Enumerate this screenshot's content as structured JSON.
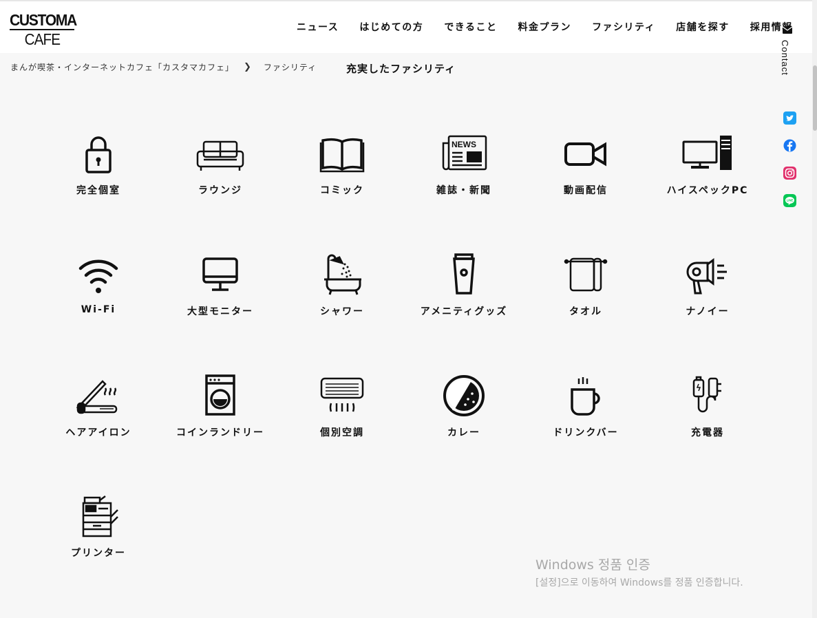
{
  "logo": {
    "line1": "CUSTOMA",
    "line2": "CAFE"
  },
  "nav": [
    "ニュース",
    "はじめての方",
    "できること",
    "料金プラン",
    "ファシリティ",
    "店舗を探す",
    "採用情報"
  ],
  "breadcrumb": {
    "home": "まんが喫茶・インターネットカフェ「カスタマカフェ」",
    "current": "ファシリティ"
  },
  "page_title": "充実したファシリティ",
  "facilities": [
    {
      "label": "完全個室",
      "icon": "padlock-icon"
    },
    {
      "label": "ラウンジ",
      "icon": "sofa-icon"
    },
    {
      "label": "コミック",
      "icon": "open-book-icon"
    },
    {
      "label": "雑誌・新聞",
      "icon": "newspaper-icon"
    },
    {
      "label": "動画配信",
      "icon": "video-camera-icon"
    },
    {
      "label": "ハイスペックPC",
      "icon": "desktop-pc-icon"
    },
    {
      "label": "Wi-Fi",
      "icon": "wifi-icon"
    },
    {
      "label": "大型モニター",
      "icon": "monitor-icon"
    },
    {
      "label": "シャワー",
      "icon": "shower-bath-icon"
    },
    {
      "label": "アメニティグッズ",
      "icon": "tube-icon"
    },
    {
      "label": "タオル",
      "icon": "towel-icon"
    },
    {
      "label": "ナノイー",
      "icon": "hair-dryer-icon"
    },
    {
      "label": "ヘアアイロン",
      "icon": "hair-iron-icon"
    },
    {
      "label": "コインランドリー",
      "icon": "washing-machine-icon"
    },
    {
      "label": "個別空調",
      "icon": "air-conditioner-icon"
    },
    {
      "label": "カレー",
      "icon": "curry-icon"
    },
    {
      "label": "ドリンクバー",
      "icon": "hot-drink-icon"
    },
    {
      "label": "充電器",
      "icon": "charger-icon"
    },
    {
      "label": "プリンター",
      "icon": "printer-icon"
    }
  ],
  "side": {
    "contact": "Contact",
    "social": [
      {
        "name": "twitter-icon",
        "color": "#1da1f2"
      },
      {
        "name": "facebook-icon",
        "color": "#1877f2"
      },
      {
        "name": "instagram-icon",
        "color": "#e1306c"
      },
      {
        "name": "line-icon",
        "color": "#06c755"
      }
    ]
  },
  "watermark": {
    "line1": "Windows 정품 인증",
    "line2": "[설정]으로 이동하여 Windows를 정품 인증합니다."
  }
}
